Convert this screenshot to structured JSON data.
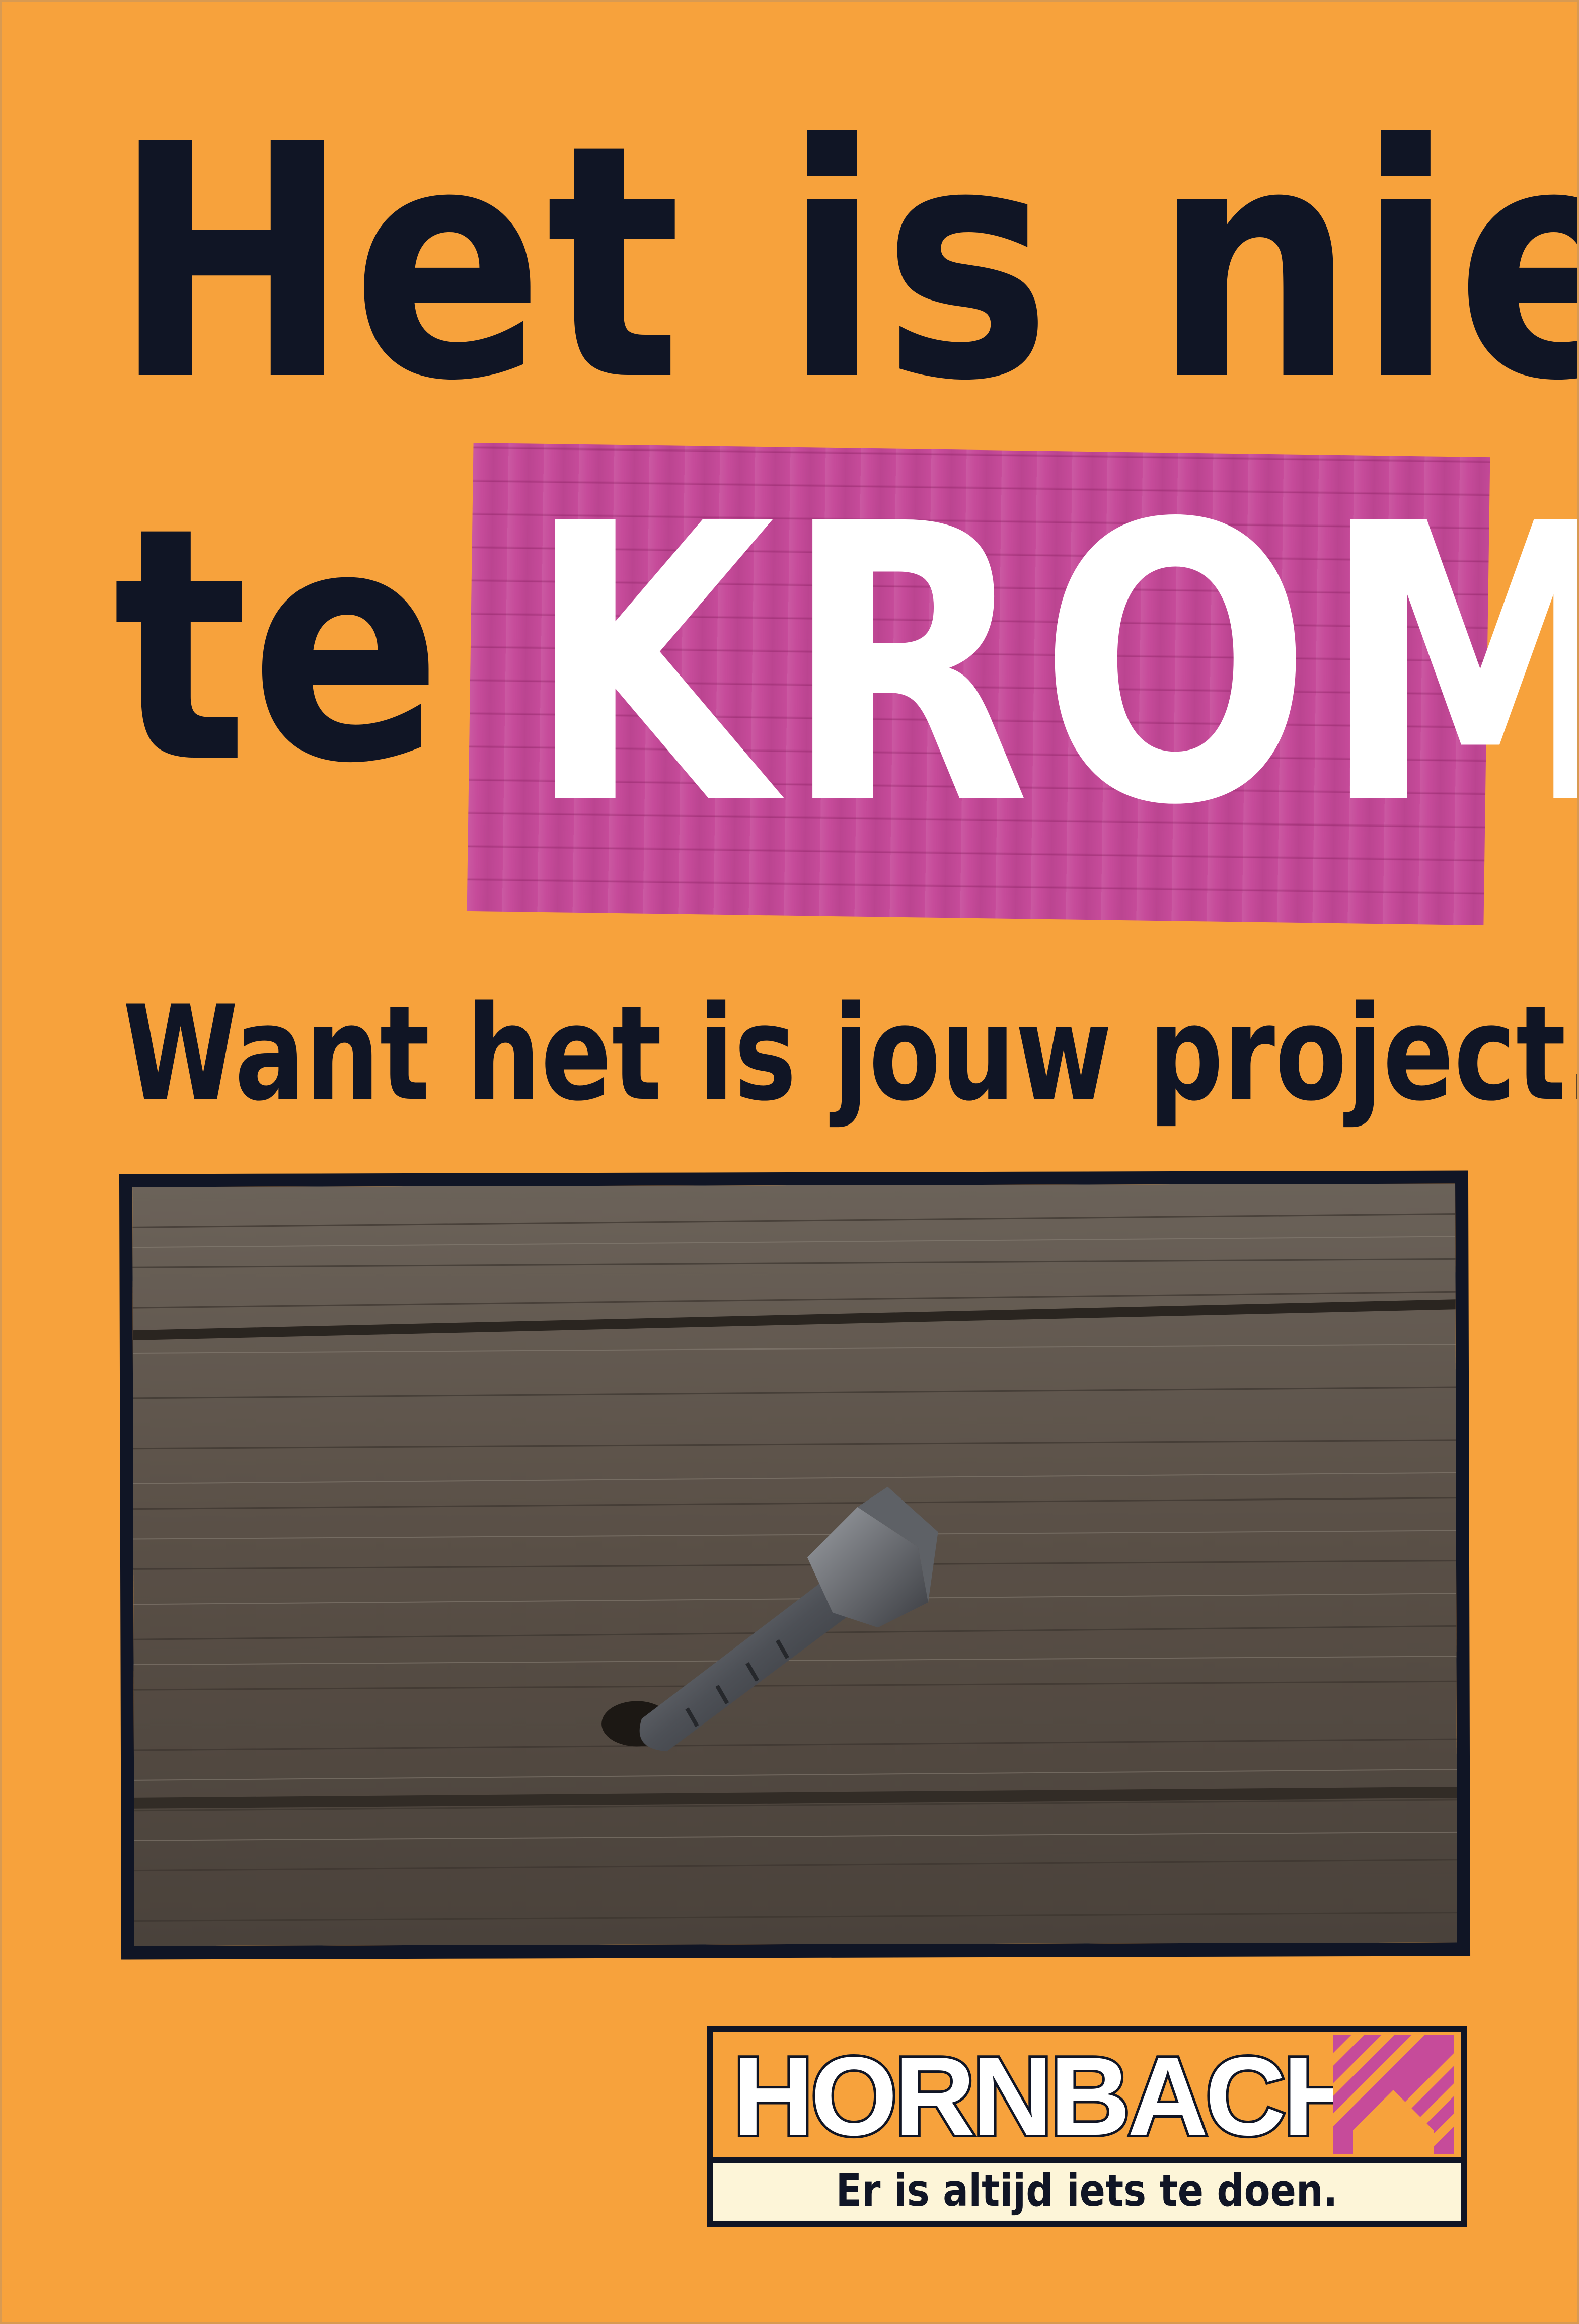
{
  "headline": {
    "line1": "Het is niet",
    "line2_prefix": "te",
    "line2_highlight": "KROM."
  },
  "subline": "Want het is jouw project.",
  "photo": {
    "subject": "bent-nail-in-wood-icon"
  },
  "brand": {
    "name": "HORNBACH",
    "tagline": "Er is altijd iets te doen.",
    "logo_mark_icon": "hornbach-house-icon"
  },
  "colors": {
    "background": "#f7a23c",
    "text_dark": "#101525",
    "highlight_pink": "#c64b9a",
    "highlight_text": "#ffffff",
    "tagline_box": "#fdf5d8"
  }
}
